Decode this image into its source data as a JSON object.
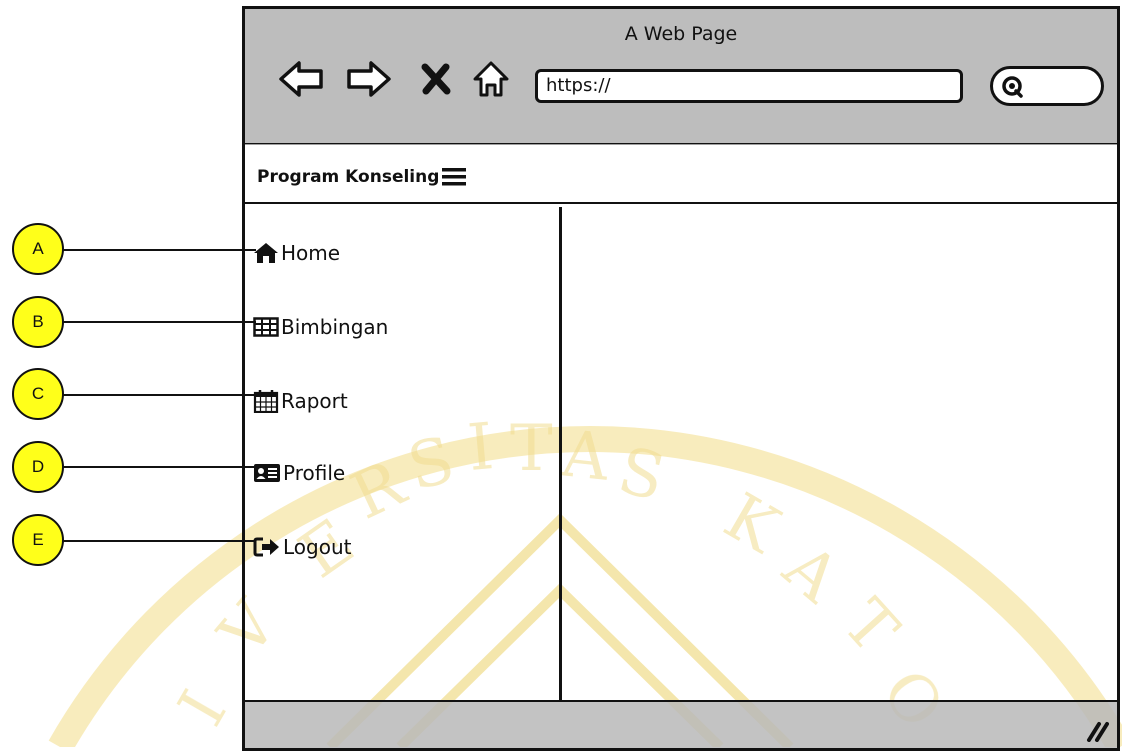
{
  "browser": {
    "page_title": "A Web Page",
    "url": "https://"
  },
  "app": {
    "brand": "Program Konseling"
  },
  "sidebar": {
    "items": [
      {
        "label": "Home",
        "icon": "home-icon"
      },
      {
        "label": "Bimbingan",
        "icon": "table-icon"
      },
      {
        "label": "Raport",
        "icon": "calendar-icon"
      },
      {
        "label": "Profile",
        "icon": "id-card-icon"
      },
      {
        "label": "Logout",
        "icon": "sign-out-icon"
      }
    ]
  },
  "callouts": [
    "A",
    "B",
    "C",
    "D",
    "E"
  ],
  "colors": {
    "callout_fill": "#ffff1a",
    "chrome_gray": "#b9b9b9",
    "watermark": "#f2d97a"
  }
}
